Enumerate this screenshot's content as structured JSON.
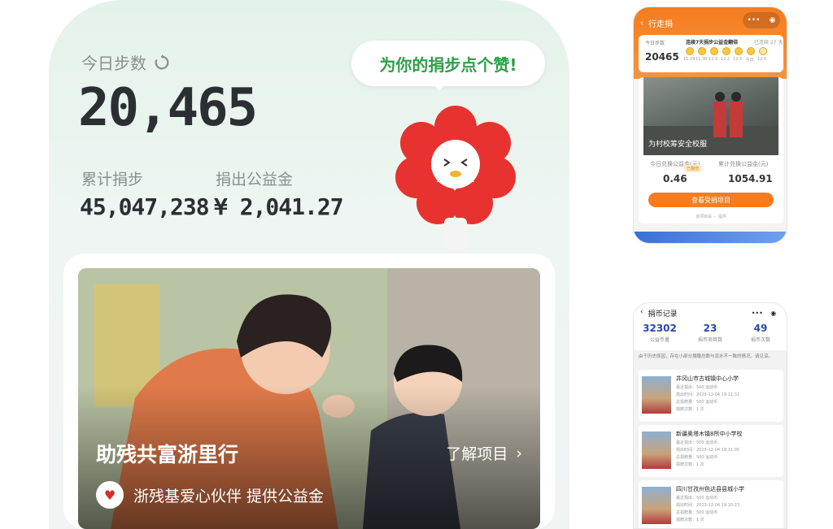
{
  "main": {
    "steps_label": "今日步数",
    "steps_value": "20,465",
    "cumulative_label": "累计捐步",
    "cumulative_value": "45,047,238",
    "donated_label": "捐出公益金",
    "donated_value": "¥ 2,041.27",
    "bubble_text": "为你的捐步点个赞!",
    "project_title": "助残共富浙里行",
    "project_more": "了解项目",
    "project_sub": "浙残基爱心伙伴 提供公益金"
  },
  "phone1": {
    "title": "行走捐",
    "today_steps_label": "今日步数",
    "today_steps_value": "20465",
    "streak_text": "连续7天捐步公益金翻倍",
    "streak_days": "已连续 27 天",
    "dates": [
      "11.29",
      "11.30",
      "12.1",
      "12.2",
      "12.3",
      "今日",
      "12.5"
    ],
    "image_title": "为村校筹安全校服",
    "today_label": "今日兑换公益金(元)",
    "today_value": "0.46",
    "total_label": "累计兑换公益金(元)",
    "total_value": "1054.91",
    "tag": "已翻倍",
    "button": "查看受捐项目",
    "foot": "该项目由 ··· 提供"
  },
  "phone2": {
    "title": "捐币记录",
    "stats": [
      {
        "value": "32302",
        "label": "公益币量"
      },
      {
        "value": "23",
        "label": "捐币项目数"
      },
      {
        "value": "49",
        "label": "捐币次数"
      }
    ],
    "note": "由于历史原因，存在小部分捐赠总数与流水不一致的情况。请见谅。",
    "records": [
      {
        "school": "井冈山市古城镇中心小学",
        "l1": "最近捐出：500 运动币",
        "l2": "捐出时间：2023-12-04 19:11:31",
        "l3": "总捐赠量：500 运动币",
        "l4": "捐赠次数：1 次"
      },
      {
        "school": "新疆奥塔木镇8所中小学校",
        "l1": "最近捐出：500 运动币",
        "l2": "捐出时间：2023-12-04 19:11:05",
        "l3": "总捐赠量：500 运动币",
        "l4": "捐赠次数：1 次"
      },
      {
        "school": "四川甘孜州色达县县城小学",
        "l1": "最近捐出：500 运动币",
        "l2": "捐出时间：2023-12-04 19:10:23",
        "l3": "总捐赠量：500 运动币",
        "l4": "捐赠次数：1 次"
      }
    ]
  }
}
